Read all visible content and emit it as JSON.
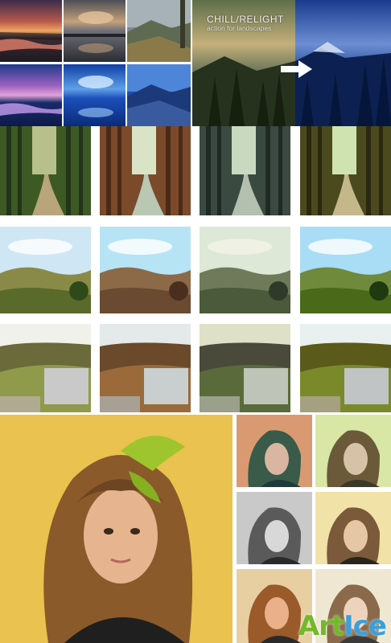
{
  "hero": {
    "title": "CHILL/RELIGHT",
    "subtitle": "action for landscapes"
  },
  "watermark": {
    "part1": "Art",
    "part2": "Ice"
  },
  "colors": {
    "arrow": "#ffffff",
    "portrait_background": "#e9c24f",
    "watermark_green": "#73b92a",
    "watermark_blue": "#3aa0dc"
  },
  "icons": [
    "right-arrow-icon"
  ]
}
